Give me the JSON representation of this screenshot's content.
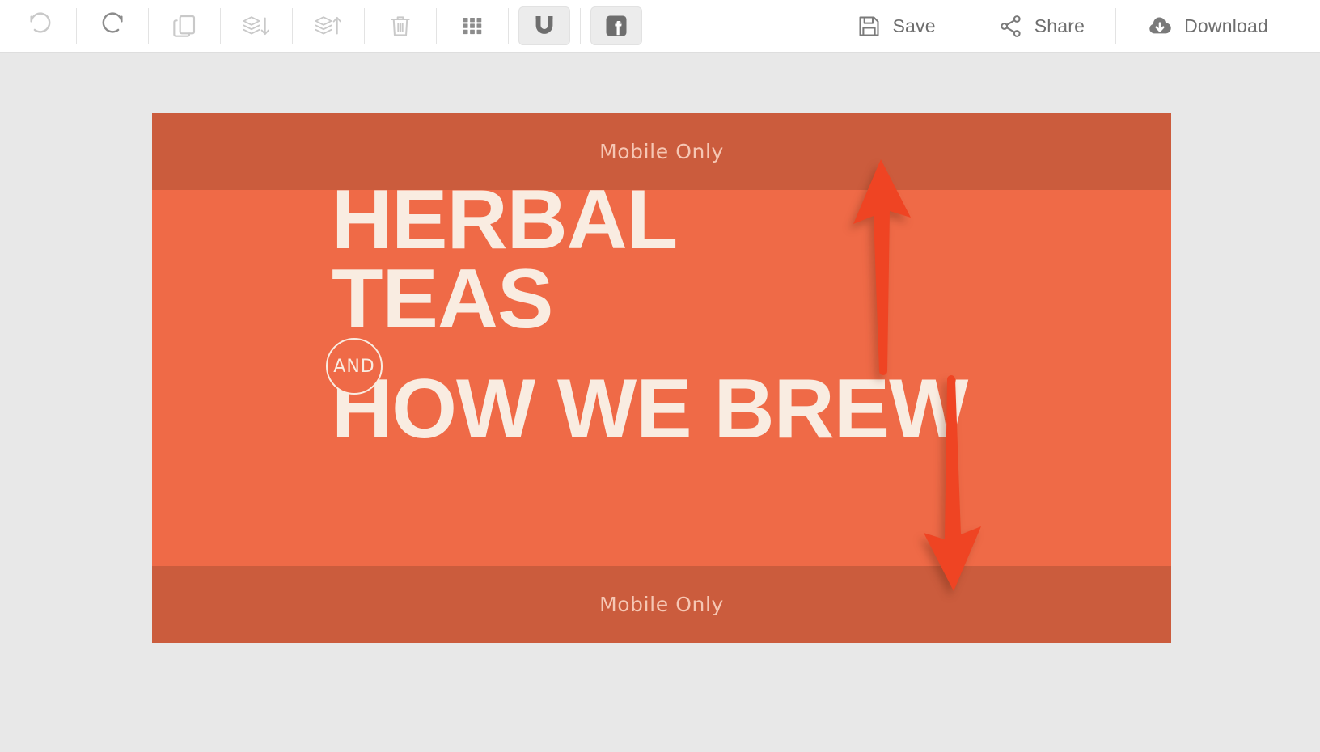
{
  "toolbar": {
    "tools": [
      {
        "name": "undo",
        "icon": "undo-icon",
        "label": "Undo",
        "state": "disabled"
      },
      {
        "name": "redo",
        "icon": "redo-icon",
        "label": "Redo",
        "state": "disabled"
      },
      {
        "name": "duplicate",
        "icon": "duplicate-icon",
        "label": "Duplicate",
        "state": "disabled"
      },
      {
        "name": "send-backward",
        "icon": "layers-down-icon",
        "label": "Send Backward",
        "state": "disabled"
      },
      {
        "name": "bring-forward",
        "icon": "layers-up-icon",
        "label": "Bring Forward",
        "state": "disabled"
      },
      {
        "name": "delete",
        "icon": "trash-icon",
        "label": "Delete",
        "state": "disabled"
      },
      {
        "name": "grid",
        "icon": "grid-icon",
        "label": "Grid",
        "state": "enabled"
      },
      {
        "name": "snap",
        "icon": "magnet-icon",
        "label": "Snap to Guides",
        "state": "active"
      },
      {
        "name": "facebook",
        "icon": "facebook-icon",
        "label": "Facebook",
        "state": "active"
      }
    ],
    "actions": [
      {
        "name": "save",
        "icon": "floppy-disk-icon",
        "label": "Save"
      },
      {
        "name": "share",
        "icon": "share-nodes-icon",
        "label": "Share"
      },
      {
        "name": "download",
        "icon": "cloud-download-icon",
        "label": "Download"
      }
    ]
  },
  "canvas": {
    "background_color": "#ef6a47",
    "text_color": "#f9ece1",
    "band_label_color": "#f6c7b4",
    "arrow_color": "#ef4423",
    "safe_area_top_label": "Mobile Only",
    "safe_area_bottom_label": "Mobile Only",
    "headline": {
      "line1": "HERBAL",
      "line2": "TEAS",
      "line3": "HOW WE",
      "line4": "BREW"
    },
    "badge": {
      "text": "AND"
    },
    "shapes": [
      {
        "name": "arrow-up",
        "direction": "up",
        "color": "#ef4423"
      },
      {
        "name": "arrow-down",
        "direction": "down",
        "color": "#ef4423"
      }
    ]
  },
  "workspace": {
    "background_color": "#e8e8e8"
  }
}
